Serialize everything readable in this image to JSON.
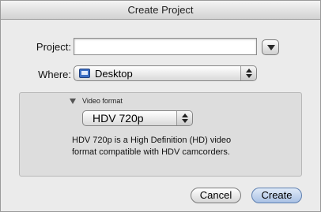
{
  "window": {
    "title": "Create Project"
  },
  "form": {
    "project_label": "Project:",
    "project_value": "",
    "where_label": "Where:",
    "where_value": "Desktop"
  },
  "video": {
    "section_label": "Video format",
    "format_value": "HDV 720p",
    "description_line1": "HDV 720p is a High Definition (HD) video",
    "description_line2": "format compatible with HDV camcorders."
  },
  "buttons": {
    "cancel": "Cancel",
    "create": "Create"
  },
  "colors": {
    "default_button": "#a9c1e4",
    "folder_icon": "#3d6fc4"
  }
}
